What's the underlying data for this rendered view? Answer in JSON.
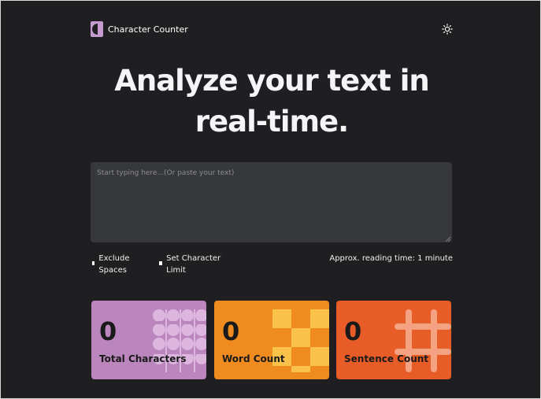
{
  "app": {
    "name": "Character Counter"
  },
  "header": {
    "logo_icon": "half-circle-logo-icon",
    "theme_icon": "sun-icon"
  },
  "hero": {
    "headline": "Analyze your text in real-time."
  },
  "editor": {
    "value": "",
    "placeholder": "Start typing here...(Or paste your text)"
  },
  "options": {
    "exclude_spaces": {
      "label": "Exclude Spaces",
      "checked": false
    },
    "set_character_limit": {
      "label": "Set Character Limit",
      "checked": false
    },
    "reading_time": "Approx. reading time: 1 minute"
  },
  "stats": [
    {
      "value": "0",
      "label": "Total Characters",
      "color": "#bb85bd",
      "pattern": "circles-grid"
    },
    {
      "value": "0",
      "label": "Word Count",
      "color": "#f08c1f",
      "pattern": "checker"
    },
    {
      "value": "0",
      "label": "Sentence Count",
      "color": "#e85d27",
      "pattern": "hash-grid"
    }
  ]
}
